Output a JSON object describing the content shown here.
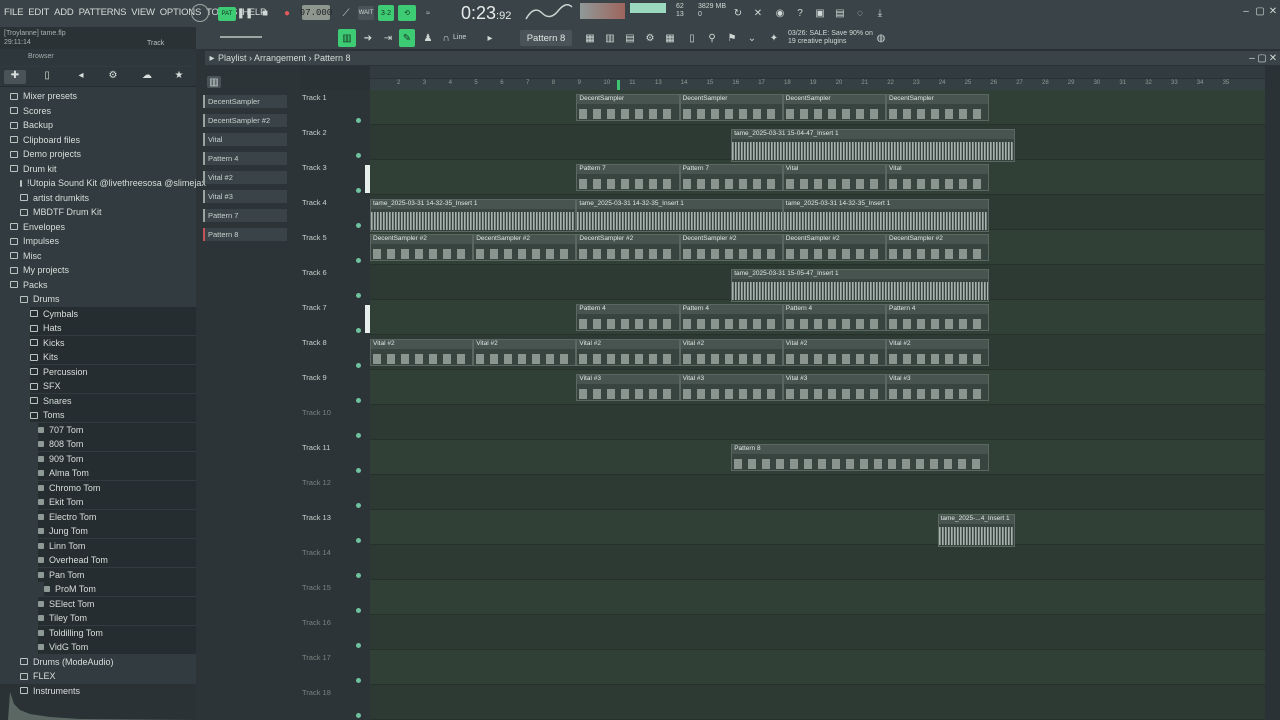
{
  "menu": [
    "FILE",
    "EDIT",
    "ADD",
    "PATTERNS",
    "VIEW",
    "OPTIONS",
    "TOOLS",
    "HELP"
  ],
  "project": {
    "name": "[Troylanne] tame.flp",
    "time": "29:11:14",
    "track_label": "Track 12"
  },
  "transport": {
    "tempo": "97.000",
    "timer_main": "0:23",
    "timer_small": ":92",
    "cpu": "62",
    "cpu_sub": "13",
    "memory": "3829 MB",
    "memory_sub": "0"
  },
  "toolbar2": {
    "pattern_selector": "Pattern 8",
    "snap": "Line",
    "news": "03/26: SALE: Save 90% on",
    "news2": "19 creative plugins"
  },
  "browser": {
    "title": "Browser",
    "items": [
      {
        "label": "Mixer presets",
        "indent": 0
      },
      {
        "label": "Scores",
        "indent": 0
      },
      {
        "label": "Backup",
        "indent": 0
      },
      {
        "label": "Clipboard files",
        "indent": 0
      },
      {
        "label": "Demo projects",
        "indent": 0
      },
      {
        "label": "Drum kit",
        "indent": 0
      },
      {
        "label": "!Utopia Sound Kit @livethreesosa @slimejax",
        "indent": 1
      },
      {
        "label": "artist drumkits",
        "indent": 1
      },
      {
        "label": "MBDTF Drum Kit",
        "indent": 1
      },
      {
        "label": "Envelopes",
        "indent": 0
      },
      {
        "label": "Impulses",
        "indent": 0
      },
      {
        "label": "Misc",
        "indent": 0
      },
      {
        "label": "My projects",
        "indent": 0
      },
      {
        "label": "Packs",
        "indent": 0
      },
      {
        "label": "Drums",
        "indent": 1
      },
      {
        "label": "Cymbals",
        "indent": 2
      },
      {
        "label": "Hats",
        "indent": 2
      },
      {
        "label": "Kicks",
        "indent": 2
      },
      {
        "label": "Kits",
        "indent": 2
      },
      {
        "label": "Percussion",
        "indent": 2
      },
      {
        "label": "SFX",
        "indent": 2
      },
      {
        "label": "Snares",
        "indent": 2
      },
      {
        "label": "Toms",
        "indent": 2
      },
      {
        "label": "707 Tom",
        "indent": 3
      },
      {
        "label": "808 Tom",
        "indent": 3
      },
      {
        "label": "909 Tom",
        "indent": 3
      },
      {
        "label": "Alma Tom",
        "indent": 3
      },
      {
        "label": "Chromo Tom",
        "indent": 3
      },
      {
        "label": "Ekit Tom",
        "indent": 3
      },
      {
        "label": "Electro Tom",
        "indent": 3
      },
      {
        "label": "Jung Tom",
        "indent": 3
      },
      {
        "label": "Linn Tom",
        "indent": 3
      },
      {
        "label": "Overhead Tom",
        "indent": 3
      },
      {
        "label": "Pan Tom",
        "indent": 3
      },
      {
        "label": "ProM Tom",
        "indent": 4
      },
      {
        "label": "SElect Tom",
        "indent": 3
      },
      {
        "label": "Tiley Tom",
        "indent": 3
      },
      {
        "label": "Toldilling Tom",
        "indent": 3
      },
      {
        "label": "VidG Tom",
        "indent": 3
      },
      {
        "label": "Drums (ModeAudio)",
        "indent": 1
      },
      {
        "label": "FLEX",
        "indent": 1
      },
      {
        "label": "Instruments",
        "indent": 1
      }
    ]
  },
  "channels": [
    "DecentSampler",
    "DecentSampler #2",
    "Vital",
    "Pattern 4",
    "Vital #2",
    "Vital #3",
    "Pattern 7",
    "Pattern 8"
  ],
  "playlist": {
    "breadcrumb": "Playlist › Arrangement › Pattern 8",
    "ruler": [
      "2",
      "3",
      "4",
      "5",
      "6",
      "7",
      "8",
      "9",
      "10",
      "11",
      "13",
      "14",
      "15",
      "16",
      "17",
      "18",
      "19",
      "20",
      "21",
      "22",
      "23",
      "24",
      "25",
      "26",
      "27",
      "28",
      "29",
      "30",
      "31",
      "32",
      "33",
      "34",
      "35"
    ],
    "tracks": [
      "Track 1",
      "Track 2",
      "Track 3",
      "Track 4",
      "Track 5",
      "Track 6",
      "Track 7",
      "Track 8",
      "Track 9",
      "Track 10",
      "Track 11",
      "Track 12",
      "Track 13",
      "Track 14",
      "Track 15",
      "Track 16",
      "Track 17",
      "Track 18"
    ],
    "clips": [
      {
        "label": "DecentSampler",
        "track": 0,
        "start": 9,
        "len": 4,
        "kind": "notes"
      },
      {
        "label": "DecentSampler",
        "track": 0,
        "start": 13,
        "len": 4,
        "kind": "notes"
      },
      {
        "label": "DecentSampler",
        "track": 0,
        "start": 17,
        "len": 4,
        "kind": "notes"
      },
      {
        "label": "DecentSampler",
        "track": 0,
        "start": 21,
        "len": 4,
        "kind": "notes"
      },
      {
        "label": "tame_2025-03-31 15-04-47_Insert 1",
        "track": 1,
        "start": 15,
        "len": 11,
        "kind": "audio"
      },
      {
        "label": "Pattern 7",
        "track": 2,
        "start": 9,
        "len": 4,
        "kind": "notes"
      },
      {
        "label": "Pattern 7",
        "track": 2,
        "start": 13,
        "len": 4,
        "kind": "notes"
      },
      {
        "label": "Vital",
        "track": 2,
        "start": 17,
        "len": 4,
        "kind": "notes"
      },
      {
        "label": "Vital",
        "track": 2,
        "start": 21,
        "len": 4,
        "kind": "notes"
      },
      {
        "label": "tame_2025-03-31 14-32-35_Insert 1",
        "track": 3,
        "start": 1,
        "len": 8,
        "kind": "audio"
      },
      {
        "label": "tame_2025-03-31 14-32-35_Insert 1",
        "track": 3,
        "start": 9,
        "len": 8,
        "kind": "audio"
      },
      {
        "label": "tame_2025-03-31 14-32-35_Insert 1",
        "track": 3,
        "start": 17,
        "len": 8,
        "kind": "audio"
      },
      {
        "label": "DecentSampler #2",
        "track": 4,
        "start": 1,
        "len": 4,
        "kind": "notes"
      },
      {
        "label": "DecentSampler #2",
        "track": 4,
        "start": 5,
        "len": 4,
        "kind": "notes"
      },
      {
        "label": "DecentSampler #2",
        "track": 4,
        "start": 9,
        "len": 4,
        "kind": "notes"
      },
      {
        "label": "DecentSampler #2",
        "track": 4,
        "start": 13,
        "len": 4,
        "kind": "notes"
      },
      {
        "label": "DecentSampler #2",
        "track": 4,
        "start": 17,
        "len": 4,
        "kind": "notes"
      },
      {
        "label": "DecentSampler #2",
        "track": 4,
        "start": 21,
        "len": 4,
        "kind": "notes"
      },
      {
        "label": "tame_2025-03-31 15-05-47_Insert 1",
        "track": 5,
        "start": 15,
        "len": 10,
        "kind": "audio"
      },
      {
        "label": "Pattern 4",
        "track": 6,
        "start": 9,
        "len": 4,
        "kind": "notes"
      },
      {
        "label": "Pattern 4",
        "track": 6,
        "start": 13,
        "len": 4,
        "kind": "notes"
      },
      {
        "label": "Pattern 4",
        "track": 6,
        "start": 17,
        "len": 4,
        "kind": "notes"
      },
      {
        "label": "Pattern 4",
        "track": 6,
        "start": 21,
        "len": 4,
        "kind": "notes"
      },
      {
        "label": "Vital #2",
        "track": 7,
        "start": 1,
        "len": 4,
        "kind": "notes"
      },
      {
        "label": "Vital #2",
        "track": 7,
        "start": 5,
        "len": 4,
        "kind": "notes"
      },
      {
        "label": "Vital #2",
        "track": 7,
        "start": 9,
        "len": 4,
        "kind": "notes"
      },
      {
        "label": "Vital #2",
        "track": 7,
        "start": 13,
        "len": 4,
        "kind": "notes"
      },
      {
        "label": "Vital #2",
        "track": 7,
        "start": 17,
        "len": 4,
        "kind": "notes"
      },
      {
        "label": "Vital #2",
        "track": 7,
        "start": 21,
        "len": 4,
        "kind": "notes"
      },
      {
        "label": "Vital #3",
        "track": 8,
        "start": 9,
        "len": 4,
        "kind": "notes"
      },
      {
        "label": "Vital #3",
        "track": 8,
        "start": 13,
        "len": 4,
        "kind": "notes"
      },
      {
        "label": "Vital #3",
        "track": 8,
        "start": 17,
        "len": 4,
        "kind": "notes"
      },
      {
        "label": "Vital #3",
        "track": 8,
        "start": 21,
        "len": 4,
        "kind": "notes"
      },
      {
        "label": "Pattern 8",
        "track": 10,
        "start": 15,
        "len": 10,
        "kind": "notes"
      },
      {
        "label": "tame_2025-...4_Insert 1",
        "track": 12,
        "start": 23,
        "len": 3,
        "kind": "audio"
      }
    ]
  }
}
